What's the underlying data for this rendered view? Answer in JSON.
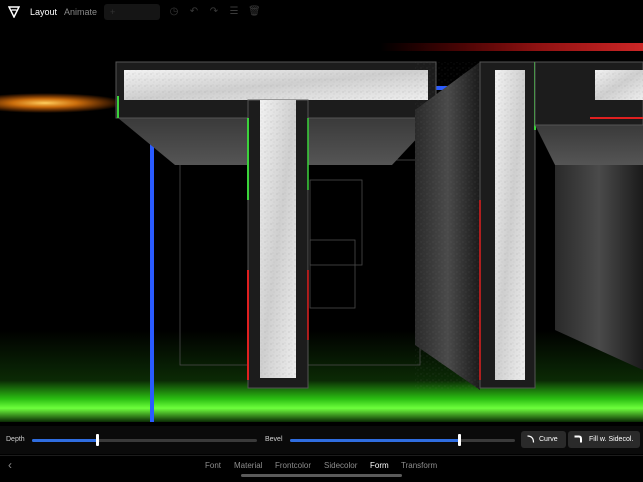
{
  "topbar": {
    "logo_icon": "app-logo-icon",
    "tabs": [
      {
        "label": "Layout",
        "active": true
      },
      {
        "label": "Animate",
        "active": false
      }
    ],
    "toolbar_icons": [
      "add-icon",
      "clock-icon",
      "undo-icon",
      "redo-icon",
      "list-icon",
      "trash-icon"
    ]
  },
  "scene": {
    "text_3d": "T",
    "colors": {
      "edge_green": "#3bd33b",
      "edge_red": "#e02020",
      "guide_blue": "#2a5bff",
      "glow_green": "#3ccf1e",
      "glow_orange": "#ffa51e"
    }
  },
  "controls": {
    "depth": {
      "label": "Depth",
      "value": 0.29
    },
    "bevel": {
      "label": "Bevel",
      "value": 0.75
    },
    "curve_button": "Curve",
    "fill_button": "Fill w. Sidecol."
  },
  "bottom_tabs": [
    {
      "label": "Font",
      "active": false
    },
    {
      "label": "Material",
      "active": false
    },
    {
      "label": "Frontcolor",
      "active": false
    },
    {
      "label": "Sidecolor",
      "active": false
    },
    {
      "label": "Form",
      "active": true
    },
    {
      "label": "Transform",
      "active": false
    }
  ],
  "accent": "#2f6de0"
}
